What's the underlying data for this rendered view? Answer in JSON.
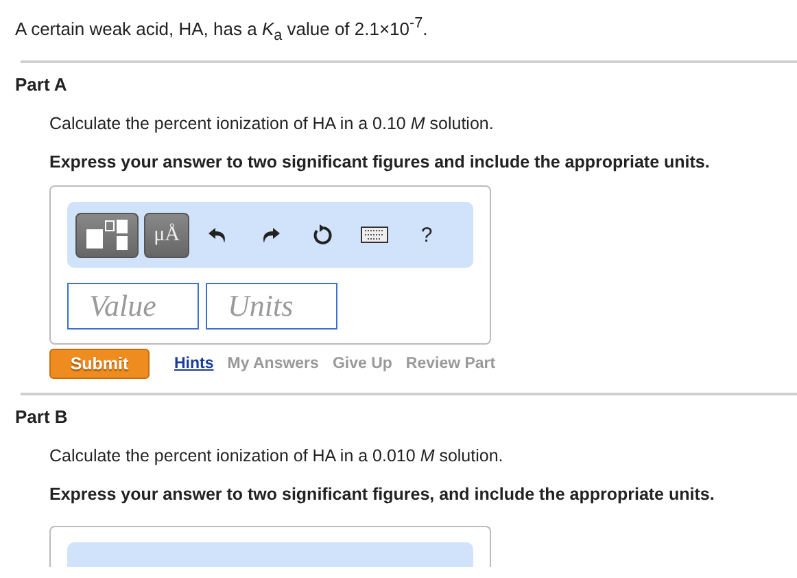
{
  "intro": "A certain weak acid, HA, has a *K*$_{a}$ value of 2.1×10$^{-7}$.",
  "parts": [
    {
      "title": "Part A",
      "question": "Calculate the percent ionization of HA in a 0.10 *M* solution.",
      "instruction": "Express your answer to two significant figures and include the appropriate units.",
      "toolbar": [
        {
          "kind": "templates"
        },
        {
          "kind": "units",
          "label": "μÅ"
        },
        {
          "kind": "undo"
        },
        {
          "kind": "redo"
        },
        {
          "kind": "reset"
        },
        {
          "kind": "keyboard"
        },
        {
          "kind": "help",
          "label": "?"
        }
      ],
      "fields": [
        {
          "placeholder": "Value"
        },
        {
          "placeholder": "Units"
        }
      ],
      "submit": "Submit",
      "links": [
        {
          "label": "Hints",
          "disabled": false
        },
        {
          "label": "My Answers",
          "disabled": true
        },
        {
          "label": "Give Up",
          "disabled": true
        },
        {
          "label": "Review Part",
          "disabled": true
        }
      ]
    },
    {
      "title": "Part B",
      "question": "Calculate the percent ionization of HA in a 0.010 *M* solution.",
      "instruction": "Express your answer to two significant figures, and include the appropriate units."
    }
  ]
}
